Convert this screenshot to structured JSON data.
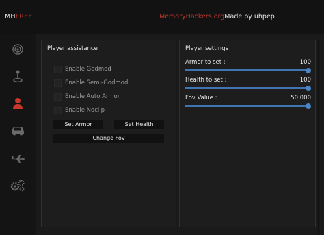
{
  "header": {
    "logo_prefix": "MH",
    "logo_suffix": "FREE",
    "site": "MemoryHackers.org",
    "author": "Made by uhpep"
  },
  "sidebar": {
    "icons": [
      "target-icon",
      "joystick-icon",
      "user-icon",
      "car-icon",
      "plane-icon",
      "gears-icon"
    ],
    "active_index": 2
  },
  "player_assistance": {
    "title": "Player assistance",
    "checkboxes": [
      {
        "label": "Enable Godmod",
        "checked": false
      },
      {
        "label": "Enable Semi-Godmod",
        "checked": false
      },
      {
        "label": "Enable Auto Armor",
        "checked": false
      },
      {
        "label": "Enable Noclip",
        "checked": false
      }
    ],
    "set_armor_label": "Set Armor",
    "set_health_label": "Set Health",
    "change_fov_label": "Change Fov"
  },
  "player_settings": {
    "title": "Player settings",
    "sliders": [
      {
        "label": "Armor to set :",
        "value": "100",
        "fraction": 1.0
      },
      {
        "label": "Health to set :",
        "value": "100",
        "fraction": 1.0
      },
      {
        "label": "Fov Value :",
        "value": "50.000",
        "fraction": 1.0
      }
    ]
  },
  "colors": {
    "accent_red": "#c8372b",
    "slider_blue": "#4b84c4"
  }
}
